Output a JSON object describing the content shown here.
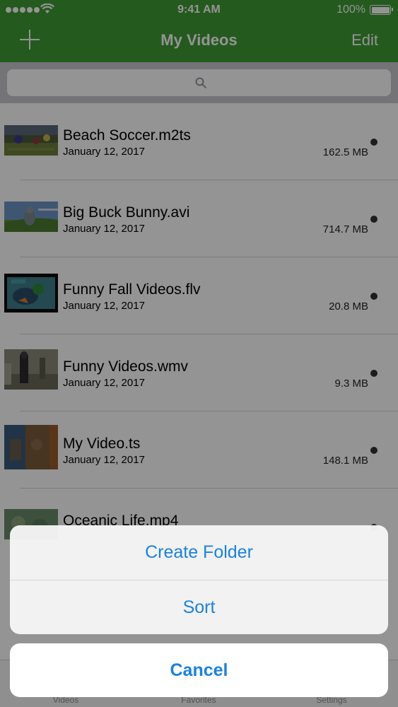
{
  "status_bar": {
    "time": "9:41 AM",
    "battery": "100%"
  },
  "nav": {
    "title": "My Videos",
    "edit_label": "Edit",
    "add_icon": "plus-icon"
  },
  "search": {
    "icon": "search-icon"
  },
  "videos": [
    {
      "name": "Beach Soccer.m2ts",
      "date": "January 12, 2017",
      "size": "162.5 MB"
    },
    {
      "name": "Big Buck Bunny.avi",
      "date": "January 12, 2017",
      "size": "714.7 MB"
    },
    {
      "name": "Funny Fall Videos.flv",
      "date": "January 12, 2017",
      "size": "20.8 MB"
    },
    {
      "name": "Funny Videos.wmv",
      "date": "January 12, 2017",
      "size": "9.3 MB"
    },
    {
      "name": "My Video.ts",
      "date": "January 12, 2017",
      "size": "148.1 MB"
    },
    {
      "name": "Oceanic Life.mp4",
      "date": "",
      "size": ""
    }
  ],
  "tab_bar": {
    "tabs": [
      {
        "label": "Videos",
        "icon": "videos-tab-icon"
      },
      {
        "label": "Favorites",
        "icon": "star-icon"
      },
      {
        "label": "Settings",
        "icon": "gear-icon"
      }
    ]
  },
  "action_sheet": {
    "create_folder": "Create Folder",
    "sort": "Sort",
    "cancel": "Cancel"
  },
  "colors": {
    "nav_green": "#3e9b35",
    "action_blue": "#1a82e0"
  }
}
